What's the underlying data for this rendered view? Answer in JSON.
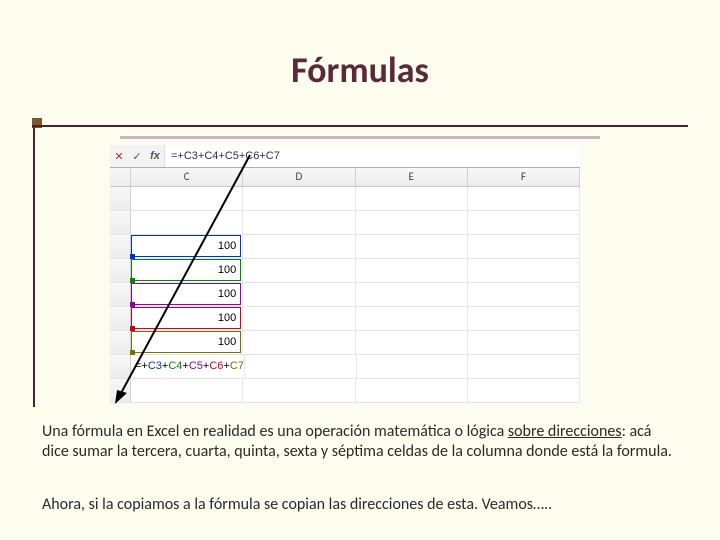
{
  "title": "Fórmulas",
  "excel": {
    "formula_bar": "=+C3+C4+C5+C6+C7",
    "columns": [
      "C",
      "D",
      "E",
      "F"
    ],
    "data_values": [
      "100",
      "100",
      "100",
      "100",
      "100"
    ],
    "highlight_colors": [
      "#0030dd",
      "#008800",
      "#9400a3",
      "#cc0020",
      "#7a6f00"
    ],
    "cell_formula_prefix": "=+",
    "cell_formula_refs": [
      "C3",
      "C4",
      "C5",
      "C6",
      "C7"
    ]
  },
  "paragraphs": {
    "p1a": "Una fórmula en Excel en realidad es una operación matemática o lógica ",
    "p1u": "sobre direcciones",
    "p1b": ": acá dice sumar la tercera, cuarta, quinta, sexta y séptima celdas de la columna donde está la formula.",
    "p2": "Ahora, si la copiamos a la fórmula se copian las direcciones de esta. Veamos….."
  }
}
